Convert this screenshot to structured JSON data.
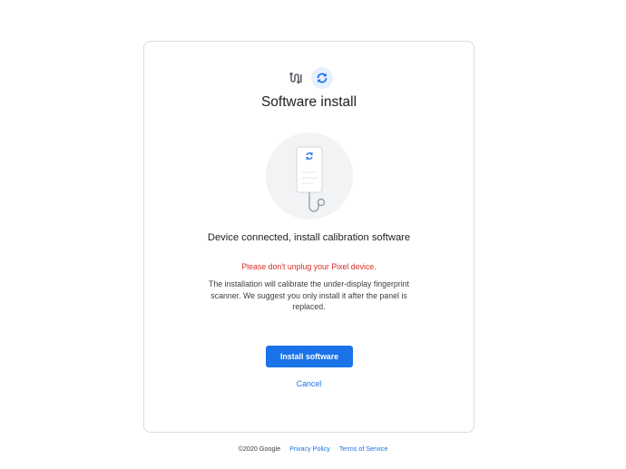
{
  "step_icons": {
    "connect_icon": "cable-connect-icon",
    "install_icon": "sync-icon"
  },
  "title": "Software install",
  "illustration_icon": "phone-connected-illustration",
  "subtitle": "Device connected, install calibration software",
  "warning": "Please don't unplug your Pixel device.",
  "body": "The installation will calibrate the under-display fingerprint scanner. We suggest you only install it after the panel is replaced.",
  "actions": {
    "install_label": "Install software",
    "cancel_label": "Cancel"
  },
  "footer": {
    "copyright": "©2020 Google",
    "privacy": "Privacy Policy",
    "terms": "Terms of Service"
  },
  "colors": {
    "accent": "#1a73e8",
    "warning": "#d93025"
  }
}
